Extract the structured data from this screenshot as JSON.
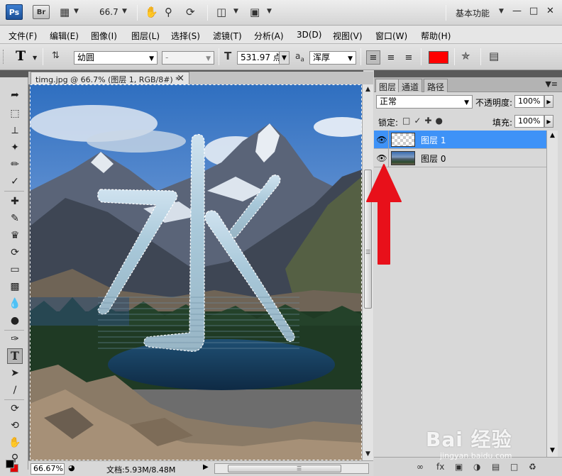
{
  "app_bar": {
    "ps_logo": "Ps",
    "br_logo": "Br",
    "zoom": "66.7",
    "workspace": "基本功能"
  },
  "menu": [
    "文件(F)",
    "编辑(E)",
    "图像(I)",
    "图层(L)",
    "选择(S)",
    "滤镜(T)",
    "分析(A)",
    "3D(D)",
    "视图(V)",
    "窗口(W)",
    "帮助(H)"
  ],
  "options": {
    "tool": "T",
    "font_family": "幼圆",
    "font_style": "-",
    "font_size": "531.97 点",
    "aa_label": "a",
    "aa_mode": "浑厚",
    "color": "#ff0000"
  },
  "document": {
    "tab_title": "timg.jpg @ 66.7% (图层 1, RGB/8#) *",
    "zoom_status": "66.67%",
    "doc_info": "文档:5.93M/8.48M"
  },
  "layers_panel": {
    "tabs": [
      "图层",
      "通道",
      "路径"
    ],
    "blend_mode": "正常",
    "opacity_label": "不透明度:",
    "opacity": "100%",
    "lock_label": "锁定:",
    "fill_label": "填充:",
    "fill": "100%",
    "layers": [
      {
        "name": "图层 1",
        "selected": true
      },
      {
        "name": "图层 0",
        "selected": false
      }
    ]
  },
  "watermark": {
    "text": "Bai 经验",
    "url": "jingyan.baidu.com"
  }
}
